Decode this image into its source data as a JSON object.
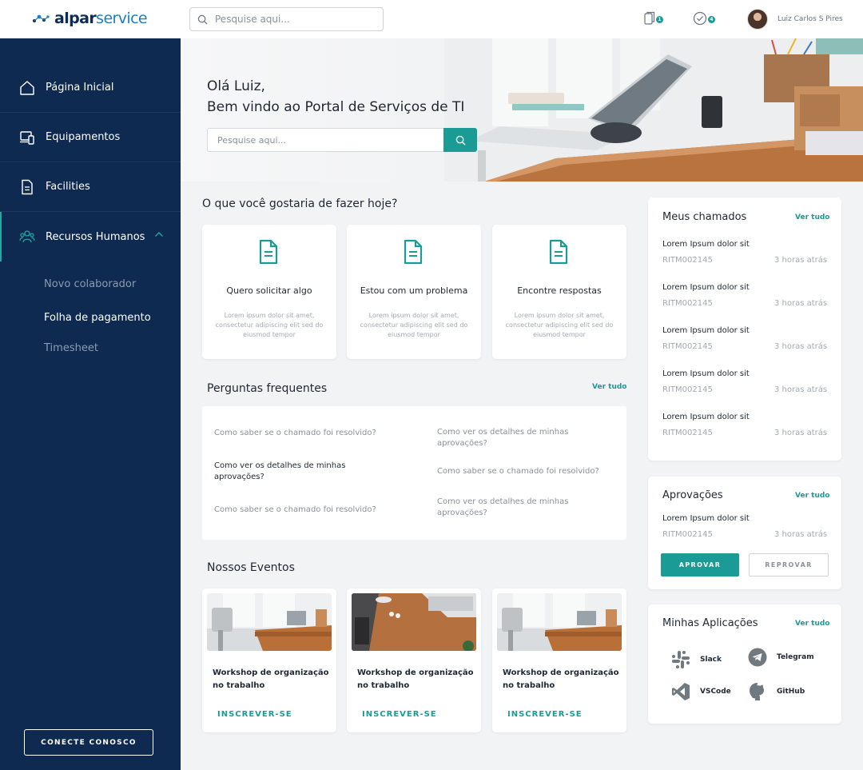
{
  "header": {
    "logo_bold": "alpar",
    "logo_light": "service",
    "search_placeholder": "Pesquise aqui...",
    "notifications_count": "1",
    "tasks_count": "4",
    "user_name": "Luiz Carlos S Pires"
  },
  "sidebar": {
    "items": [
      {
        "label": "Página Inicial",
        "icon": "home-icon"
      },
      {
        "label": "Equipamentos",
        "icon": "devices-icon"
      },
      {
        "label": "Facilities",
        "icon": "document-icon"
      },
      {
        "label": "Recursos Humanos",
        "icon": "people-icon"
      }
    ],
    "subitems": [
      "Novo colaborador",
      "Folha de pagamento",
      "Timesheet"
    ],
    "connect_label": "CONECTE CONOSCO"
  },
  "hero": {
    "greeting": "Olá Luiz,",
    "welcome": "Bem vindo ao Portal de Serviços de TI",
    "search_placeholder": "Pesquise aqui..."
  },
  "actions": {
    "title": "O que você gostaria de fazer hoje?",
    "cards": [
      {
        "title": "Quero solicitar algo",
        "desc": "Lorem ipsum dolor sit amet, consectetur adipiscing elit sed do eiusmod tempor"
      },
      {
        "title": "Estou com um problema",
        "desc": "Lorem ipsum dolor sit amet, consectetur adipiscing elit sed do eiusmod tempor"
      },
      {
        "title": "Encontre respostas",
        "desc": "Lorem ipsum dolor sit amet, consectetur adipiscing elit sed do eiusmod tempor"
      }
    ]
  },
  "faq": {
    "title": "Perguntas frequentes",
    "see_all": "Ver tudo",
    "items": [
      "Como saber se o chamado foi resolvido?",
      "Como ver os detalhes de minhas aprovações?",
      "Como ver os detalhes de minhas aprovações?",
      "Como saber se o chamado foi resolvido?",
      "Como saber se o chamado foi resolvido?",
      "Como ver os detalhes de minhas aprovações?"
    ]
  },
  "events": {
    "title": "Nossos Eventos",
    "cards": [
      {
        "title": "Workshop de organização no trabalho",
        "cta": "INSCREVER-SE"
      },
      {
        "title": "Workshop de organização no trabalho",
        "cta": "INSCREVER-SE"
      },
      {
        "title": "Workshop de organização no trabalho",
        "cta": "INSCREVER-SE"
      }
    ]
  },
  "tickets": {
    "title": "Meus chamados",
    "see_all": "Ver tudo",
    "items": [
      {
        "title": "Lorem Ipsum dolor sit",
        "id": "RITM002145",
        "time": "3 horas atrás"
      },
      {
        "title": "Lorem Ipsum dolor sit",
        "id": "RITM002145",
        "time": "3 horas atrás"
      },
      {
        "title": "Lorem Ipsum dolor sit",
        "id": "RITM002145",
        "time": "3 horas atrás"
      },
      {
        "title": "Lorem Ipsum dolor sit",
        "id": "RITM002145",
        "time": "3 horas atrás"
      },
      {
        "title": "Lorem Ipsum dolor sit",
        "id": "RITM002145",
        "time": "3 horas atrás"
      }
    ]
  },
  "approvals": {
    "title": "Aprovações",
    "see_all": "Ver tudo",
    "item": {
      "title": "Lorem Ipsum dolor sit",
      "id": "RITM002145",
      "time": "3 horas atrás"
    },
    "approve_label": "APROVAR",
    "reject_label": "REPROVAR"
  },
  "apps": {
    "title": "Minhas Aplicações",
    "see_all": "Ver tudo",
    "items": [
      {
        "label": "Slack",
        "icon": "slack-icon"
      },
      {
        "label": "Telegram",
        "icon": "telegram-icon"
      },
      {
        "label": "VSCode",
        "icon": "vscode-icon"
      },
      {
        "label": "GitHub",
        "icon": "github-icon"
      }
    ]
  },
  "colors": {
    "sidebar": "#0e2a51",
    "accent": "#1a9b96",
    "background": "#f2f3f5"
  }
}
